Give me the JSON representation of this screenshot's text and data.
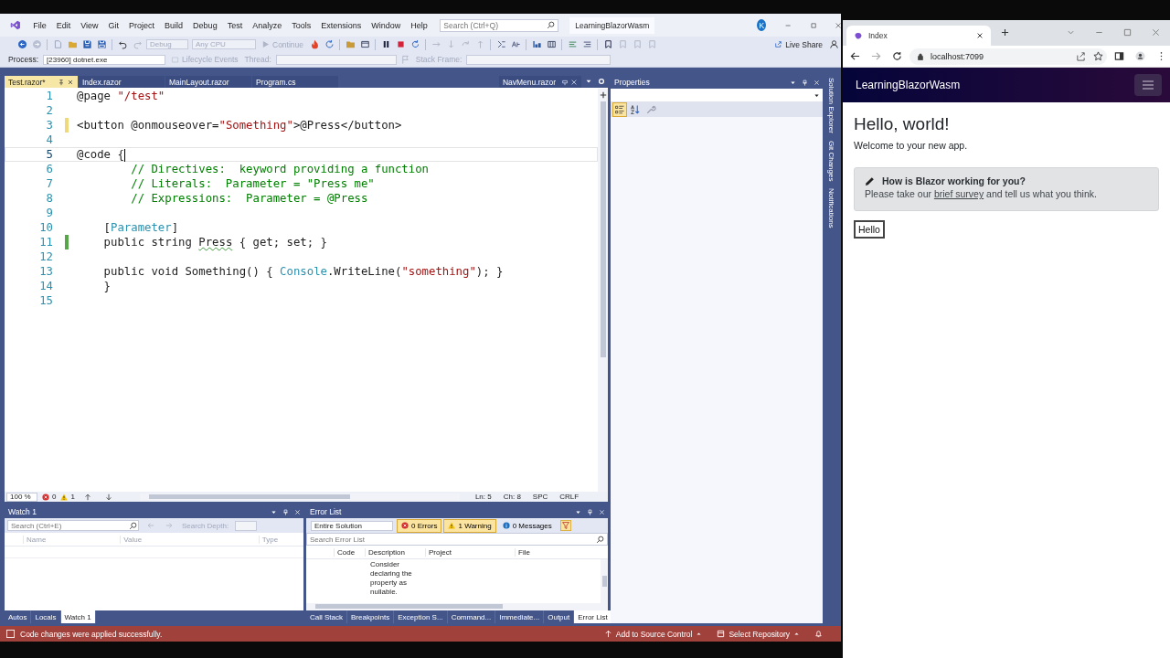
{
  "vs": {
    "menu": [
      "File",
      "Edit",
      "View",
      "Git",
      "Project",
      "Build",
      "Debug",
      "Test",
      "Analyze",
      "Tools",
      "Extensions",
      "Window",
      "Help"
    ],
    "search": {
      "placeholder": "Search (Ctrl+Q)"
    },
    "solution": "LearningBlazorWasm",
    "avatar": "K",
    "toolbar": {
      "configuration": {
        "value": "Debug",
        "disabled": true
      },
      "platform": {
        "value": "Any CPU",
        "disabled": true
      },
      "continue": {
        "label": "Continue",
        "disabled": true
      },
      "live_share": "Live Share"
    },
    "debug_bar": {
      "process_label": "Process:",
      "process": "[23960] dotnet.exe",
      "lifecycle": "Lifecycle Events",
      "thread_label": "Thread:",
      "stack_label": "Stack Frame:"
    },
    "tabs": [
      {
        "label": "Test.razor*",
        "selected": true,
        "pinned": false
      },
      {
        "label": "Index.razor",
        "selected": false,
        "pinned": false
      },
      {
        "label": "MainLayout.razor",
        "selected": false,
        "pinned": false
      },
      {
        "label": "Program.cs",
        "selected": false,
        "pinned": false
      },
      {
        "label": "NavMenu.razor",
        "selected": false,
        "pinned": true
      }
    ],
    "editor": {
      "lines": [
        {
          "number": "1",
          "current": false,
          "tokens": [
            {
              "text": "@page ",
              "kind": "plain"
            },
            {
              "text": "\"/test\"",
              "kind": "string"
            }
          ]
        },
        {
          "number": "2",
          "current": false
        },
        {
          "number": "3",
          "current": false,
          "color": "#efd97a",
          "tokens": [
            {
              "text": "<button @onmouseover=",
              "kind": "plain"
            },
            {
              "text": "\"Something\"",
              "kind": "string"
            },
            {
              "text": ">@Press</button>",
              "kind": "plain"
            }
          ]
        },
        {
          "number": "4",
          "current": false
        },
        {
          "number": "5",
          "current": true,
          "tokens": [
            {
              "text": "@code {",
              "kind": "plain"
            }
          ]
        },
        {
          "number": "6",
          "current": false,
          "tokens": [
            {
              "text": "        // Directives:  keyword providing a function",
              "kind": "comment"
            }
          ]
        },
        {
          "number": "7",
          "current": false,
          "tokens": [
            {
              "text": "        // Literals:  Parameter = \"Press me\"",
              "kind": "comment"
            }
          ]
        },
        {
          "number": "8",
          "current": false,
          "tokens": [
            {
              "text": "        // Expressions:  Parameter = @Press",
              "kind": "comment"
            }
          ]
        },
        {
          "number": "9",
          "current": false
        },
        {
          "number": "10",
          "current": false,
          "tokens": [
            {
              "text": "    [",
              "kind": "plain"
            },
            {
              "text": "Parameter",
              "kind": "type"
            },
            {
              "text": "]",
              "kind": "plain"
            }
          ]
        },
        {
          "number": "11",
          "current": false,
          "color": "#57a64a",
          "tokens": [
            {
              "text": "    public string ",
              "kind": "plain"
            },
            {
              "text": "Press",
              "kind": "warned"
            },
            {
              "text": " { get; set; }",
              "kind": "plain"
            }
          ]
        },
        {
          "number": "12",
          "current": false
        },
        {
          "number": "13",
          "current": false,
          "tokens": [
            {
              "text": "    public void Something() { ",
              "kind": "plain"
            },
            {
              "text": "Console",
              "kind": "type"
            },
            {
              "text": ".WriteLine(",
              "kind": "plain"
            },
            {
              "text": "\"something\"",
              "kind": "string"
            },
            {
              "text": "); }",
              "kind": "plain"
            }
          ]
        },
        {
          "number": "14",
          "current": false,
          "tokens": [
            {
              "text": "    }",
              "kind": "plain"
            }
          ]
        },
        {
          "number": "15",
          "current": false
        }
      ]
    },
    "editor_status": {
      "zoom": "100 %",
      "errors": "0",
      "warnings": "1",
      "line": "Ln: 5",
      "column": "Ch: 8",
      "whitespace": "SPC",
      "line_ending": "CRLF"
    },
    "properties": {
      "title": "Properties"
    },
    "side_tabs": [
      "Solution Explorer",
      "Git Changes",
      "Notifications"
    ],
    "watch": {
      "title": "Watch 1",
      "search": {
        "placeholder": "Search (Ctrl+E)"
      },
      "depth_label": "Search Depth:",
      "columns": [
        "Name",
        "Value",
        "Type"
      ],
      "tabs": [
        {
          "label": "Autos",
          "selected": false
        },
        {
          "label": "Locals",
          "selected": false
        },
        {
          "label": "Watch 1",
          "selected": true
        }
      ]
    },
    "error_list": {
      "title": "Error List",
      "scope": "Entire Solution",
      "filters": [
        {
          "label": "0 Errors",
          "kind": "error",
          "selected": true
        },
        {
          "label": "1 Warning",
          "kind": "warning",
          "selected": true
        },
        {
          "label": "0 Messages",
          "kind": "message",
          "selected": false
        }
      ],
      "search": {
        "placeholder": "Search Error List"
      },
      "columns": [
        "Code",
        "Description",
        "Project",
        "File"
      ],
      "row": {
        "description": "Consider declaring the property as nullable."
      },
      "tabs": [
        {
          "label": "Call Stack",
          "selected": false
        },
        {
          "label": "Breakpoints",
          "selected": false
        },
        {
          "label": "Exception S...",
          "selected": false
        },
        {
          "label": "Command...",
          "selected": false
        },
        {
          "label": "Immediate...",
          "selected": false
        },
        {
          "label": "Output",
          "selected": false
        },
        {
          "label": "Error List",
          "selected": true
        }
      ]
    },
    "status_bar": {
      "message": "Code changes were applied successfully.",
      "source_control": "Add to Source Control",
      "repository": "Select Repository"
    }
  },
  "browser": {
    "tab": "Index",
    "url": "localhost:7099",
    "brand": "LearningBlazorWasm",
    "heading": "Hello, world!",
    "welcome": "Welcome to your new app.",
    "survey": {
      "title": "How is Blazor working for you?",
      "before": "Please take our",
      "link": "brief survey",
      "after": "and tell us what you think."
    },
    "button": "Hello"
  }
}
